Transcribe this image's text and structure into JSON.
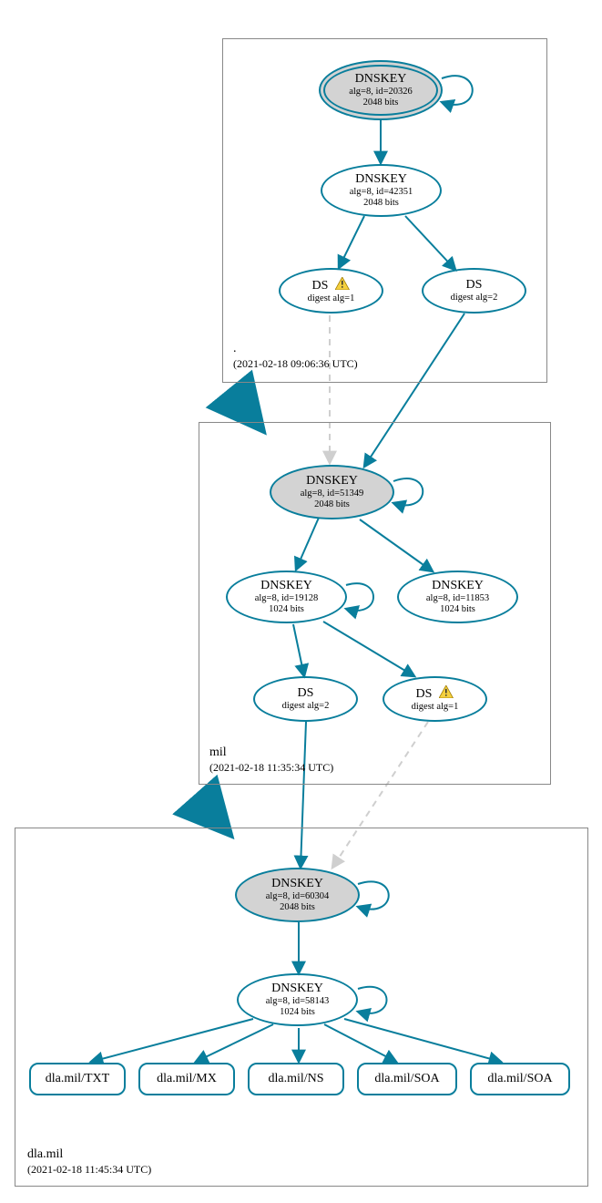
{
  "stroke_color": "#097e9c",
  "zones": {
    "root": {
      "label": ".",
      "timestamp": "(2021-02-18 09:06:36 UTC)"
    },
    "mil": {
      "label": "mil",
      "timestamp": "(2021-02-18 11:35:34 UTC)"
    },
    "dla": {
      "label": "dla.mil",
      "timestamp": "(2021-02-18 11:45:34 UTC)"
    }
  },
  "nodes": {
    "root_ksk": {
      "title": "DNSKEY",
      "line1": "alg=8, id=20326",
      "line2": "2048 bits"
    },
    "root_zsk": {
      "title": "DNSKEY",
      "line1": "alg=8, id=42351",
      "line2": "2048 bits"
    },
    "root_ds1": {
      "title": "DS",
      "line1": "digest alg=1",
      "warn": true
    },
    "root_ds2": {
      "title": "DS",
      "line1": "digest alg=2"
    },
    "mil_ksk": {
      "title": "DNSKEY",
      "line1": "alg=8, id=51349",
      "line2": "2048 bits"
    },
    "mil_zsk1": {
      "title": "DNSKEY",
      "line1": "alg=8, id=19128",
      "line2": "1024 bits"
    },
    "mil_zsk2": {
      "title": "DNSKEY",
      "line1": "alg=8, id=11853",
      "line2": "1024 bits"
    },
    "mil_ds2": {
      "title": "DS",
      "line1": "digest alg=2"
    },
    "mil_ds1": {
      "title": "DS",
      "line1": "digest alg=1",
      "warn": true
    },
    "dla_ksk": {
      "title": "DNSKEY",
      "line1": "alg=8, id=60304",
      "line2": "2048 bits"
    },
    "dla_zsk": {
      "title": "DNSKEY",
      "line1": "alg=8, id=58143",
      "line2": "1024 bits"
    },
    "rr_txt": {
      "title": "dla.mil/TXT"
    },
    "rr_mx": {
      "title": "dla.mil/MX"
    },
    "rr_ns": {
      "title": "dla.mil/NS"
    },
    "rr_soa1": {
      "title": "dla.mil/SOA"
    },
    "rr_soa2": {
      "title": "dla.mil/SOA"
    }
  }
}
